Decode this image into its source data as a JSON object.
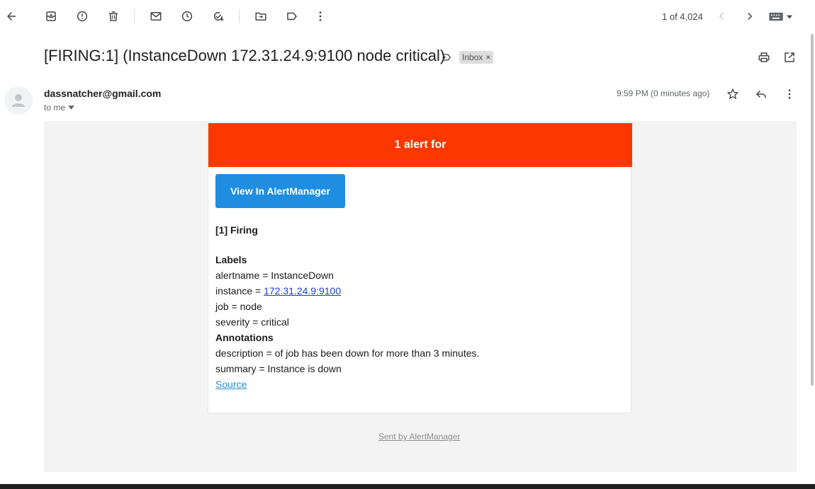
{
  "toolbar": {
    "pager_text": "1 of 4,024"
  },
  "email": {
    "subject": "[FIRING:1] (InstanceDown 172.31.24.9:9100 node critical)",
    "label_chip": "Inbox",
    "label_chip_close": "×",
    "sender": "dassnatcher@gmail.com",
    "recipient": "to me",
    "time": "9:59 PM (0 minutes ago)"
  },
  "alert": {
    "header": "1 alert for",
    "button_label": "View In AlertManager",
    "firing": "[1] Firing",
    "labels_heading": "Labels",
    "alertname": "alertname = InstanceDown",
    "instance_prefix": "instance = ",
    "instance_link": "172.31.24.9:9100",
    "job": "job = node",
    "severity": "severity = critical",
    "annotations_heading": "Annotations",
    "description": "description = of job has been down for more than 3 minutes.",
    "summary": "summary = Instance is down",
    "source_link": "Source",
    "footer": "Sent by AlertManager"
  },
  "colors": {
    "alert_header": "#fc3700",
    "button": "#1f8ee0",
    "link": "#1a3ec8"
  }
}
